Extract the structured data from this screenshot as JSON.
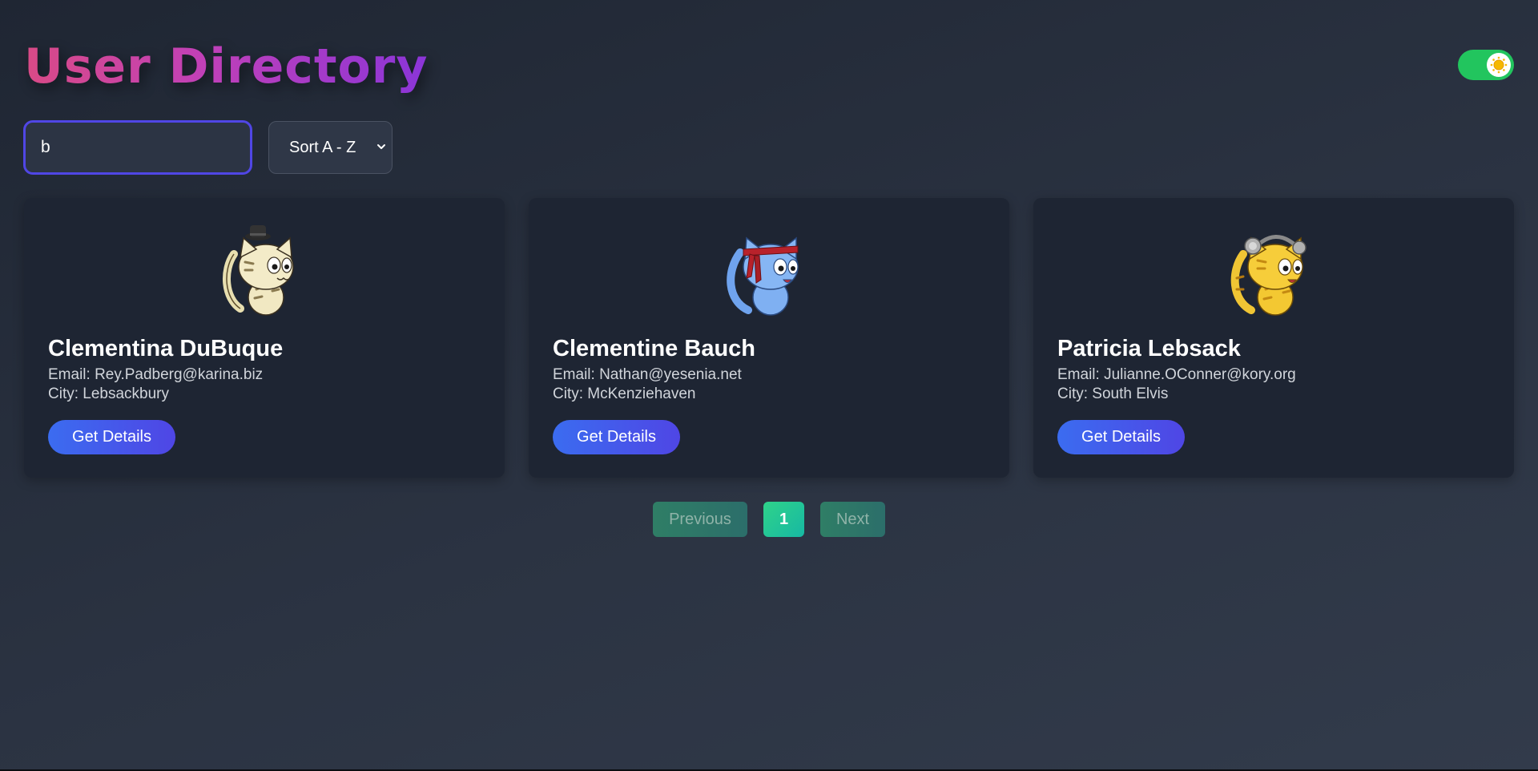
{
  "header": {
    "title": "User Directory",
    "theme_toggle": {
      "state": "on",
      "icon": "sun-icon",
      "color": "#22c55e"
    }
  },
  "controls": {
    "search": {
      "value": "b",
      "placeholder": ""
    },
    "sort": {
      "selected": "Sort A - Z"
    }
  },
  "users": [
    {
      "name": "Clementina DuBuque",
      "email": "Email: Rey.Padberg@karina.biz",
      "city": "City: Lebsackbury",
      "button": "Get Details",
      "avatar": "cat-with-hat-avatar"
    },
    {
      "name": "Clementine Bauch",
      "email": "Email: Nathan@yesenia.net",
      "city": "City: McKenziehaven",
      "button": "Get Details",
      "avatar": "cat-with-headband-avatar"
    },
    {
      "name": "Patricia Lebsack",
      "email": "Email: Julianne.OConner@kory.org",
      "city": "City: South Elvis",
      "button": "Get Details",
      "avatar": "cat-with-headphones-avatar"
    }
  ],
  "pagination": {
    "previous": "Previous",
    "current": "1",
    "next": "Next"
  },
  "colors": {
    "accent": "#4f46e5",
    "title_gradient_start": "#d94a86",
    "title_gradient_end": "#8b35d8",
    "pagination_active": "#2fd38a"
  }
}
